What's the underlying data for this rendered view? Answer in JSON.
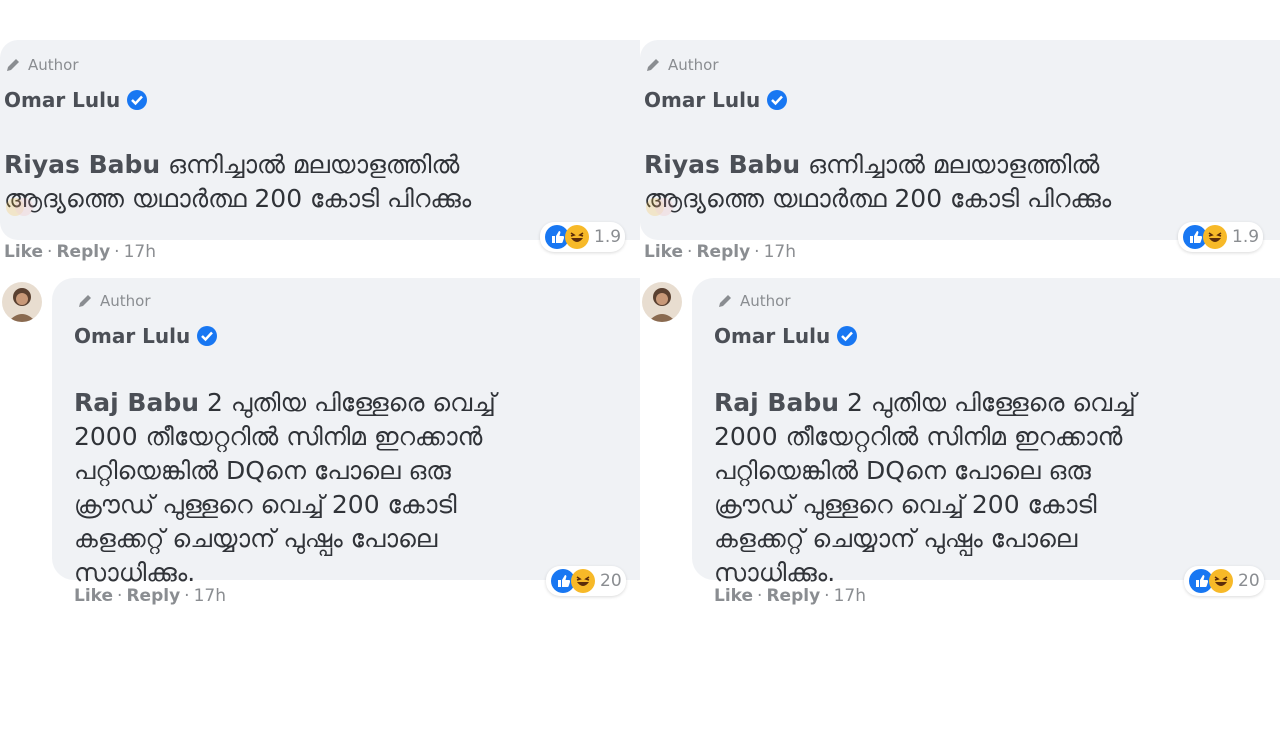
{
  "panels": [
    {
      "comment": {
        "author_badge": "Author",
        "name": "Omar Lulu",
        "mention": "Riyas Babu",
        "text": " ഒന്നിച്ചാൽ മലയാളത്തിൽ\nആദ്യത്തെ യഥാർത്ഥ 200 കോടി പിറക്കും",
        "actions": {
          "like": "Like",
          "reply": "Reply",
          "time": "17h"
        },
        "reaction_count": "1.9"
      },
      "reply": {
        "author_badge": "Author",
        "name": "Omar Lulu",
        "mention": "Raj Babu",
        "text": " 2 പുതിയ പിള്ളേരെ വെച്ച്\n2000 തീയേറ്ററിൽ സിനിമ ഇറക്കാൻ\nപറ്റിയെങ്കിൽ DQനെ പോലെ ഒരു\nക്രൗഡ് പുള്ളറെ വെച്ച് 200 കോടി\nകളക്കറ്റ് ചെയ്യാന് പുഷ്പം പോലെ\nസാധിക്കും.",
        "actions": {
          "like": "Like",
          "reply": "Reply",
          "time": "17h"
        },
        "reaction_count": "20"
      }
    },
    {
      "comment": {
        "author_badge": "Author",
        "name": "Omar Lulu",
        "mention": "Riyas Babu",
        "text": " ഒന്നിച്ചാൽ മലയാളത്തിൽ\nആദ്യത്തെ യഥാർത്ഥ 200 കോടി പിറക്കും",
        "actions": {
          "like": "Like",
          "reply": "Reply",
          "time": "17h"
        },
        "reaction_count": "1.9"
      },
      "reply": {
        "author_badge": "Author",
        "name": "Omar Lulu",
        "mention": "Raj Babu",
        "text": " 2 പുതിയ പിള്ളേരെ വെച്ച്\n2000 തീയേറ്ററിൽ സിനിമ ഇറക്കാൻ\nപറ്റിയെങ്കിൽ DQനെ പോലെ ഒരു\nക്രൗഡ് പുള്ളറെ വെച്ച് 200 കോടി\nകളക്കറ്റ് ചെയ്യാന് പുഷ്പം പോലെ\nസാധിക്കും.",
        "actions": {
          "like": "Like",
          "reply": "Reply",
          "time": "17h"
        },
        "reaction_count": "20"
      }
    }
  ],
  "icons": {
    "author": "pencil-icon",
    "verified": "verified-badge-icon",
    "like": "like-reaction-icon",
    "haha": "haha-reaction-icon"
  },
  "colors": {
    "bubble": "#f0f2f5",
    "verified": "#1877f2",
    "like": "#1877f2",
    "haha": "#f7b928"
  }
}
